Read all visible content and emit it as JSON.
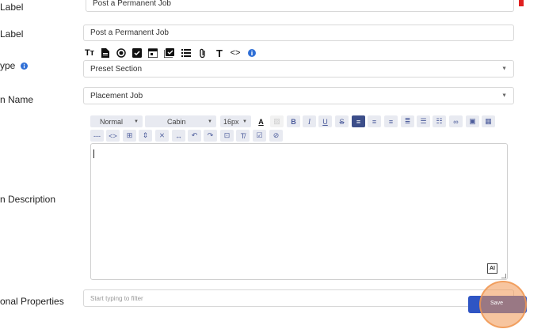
{
  "top_field": {
    "label": "Label",
    "value": "Post a Permanent Job"
  },
  "label_field": {
    "label": "Label",
    "value": "Post a Permanent Job"
  },
  "type_field": {
    "label": "ype",
    "value": "Preset Section"
  },
  "name_field": {
    "label": "n Name",
    "value": "Placement Job"
  },
  "description": {
    "label": "n Description"
  },
  "properties": {
    "label": "onal Properties",
    "placeholder": "Start typing to filter"
  },
  "editor": {
    "format": "Normal",
    "font": "Cabin",
    "size": "16px",
    "ai_label": "AI"
  },
  "field_type_icons": [
    "text-size-icon",
    "document-icon",
    "radio-icon",
    "checkbox-icon",
    "calendar-icon",
    "checklist-icon",
    "list-icon",
    "paperclip-icon",
    "text-icon",
    "code-icon",
    "info-icon"
  ],
  "save_button": {
    "label": "Save"
  },
  "colors": {
    "accent": "#2f55c4",
    "save_overlay": "#f0a35c",
    "editor_active": "#3c4e8a"
  }
}
